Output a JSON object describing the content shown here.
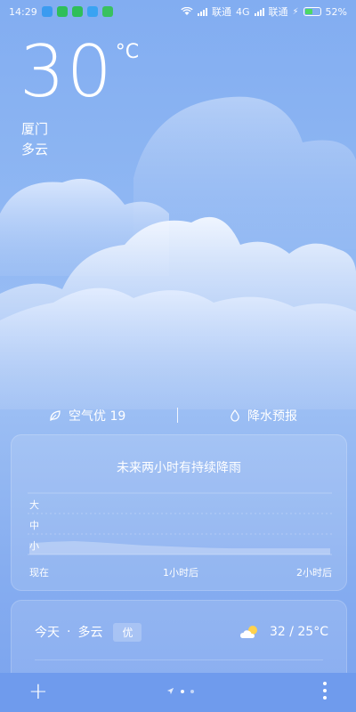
{
  "status_bar": {
    "time": "14:29",
    "carrier1": "联通",
    "network": "4G",
    "carrier2": "联通",
    "battery": "52%",
    "icons": [
      "usb-debug-icon",
      "wechat-icon",
      "wechat-icon",
      "app-icon",
      "android-icon",
      "wifi-icon",
      "signal-icon",
      "charging-icon"
    ]
  },
  "weather": {
    "temperature": "30",
    "unit": "°C",
    "city": "厦门",
    "condition": "多云"
  },
  "info_strip": {
    "aqi_label": "空气优 19",
    "precip_label": "降水预报"
  },
  "rain_card": {
    "title": "未来两小时有持续降雨",
    "y_labels": [
      "大",
      "中",
      "小"
    ],
    "x_labels": [
      "现在",
      "1小时后",
      "2小时后"
    ]
  },
  "chart_data": {
    "type": "area",
    "title": "未来两小时有持续降雨",
    "y_categories": [
      "小",
      "中",
      "大"
    ],
    "x": [
      0,
      0.15,
      0.3,
      0.45,
      0.6,
      0.75,
      0.9,
      1.05,
      1.2,
      1.35,
      1.5,
      1.65,
      1.8,
      1.95,
      2.0
    ],
    "values": [
      0.55,
      0.62,
      0.65,
      0.6,
      0.52,
      0.45,
      0.4,
      0.36,
      0.32,
      0.3,
      0.3,
      0.3,
      0.3,
      0.3,
      0.3
    ],
    "x_tick_labels": [
      "现在",
      "1小时后",
      "2小时后"
    ],
    "ylim": [
      0,
      3
    ],
    "xlim": [
      0,
      2
    ],
    "grid": true
  },
  "forecast": {
    "day": "今天",
    "separator": "·",
    "condition": "多云",
    "aqi_badge": "优",
    "temp_range": "32 / 25°C",
    "icon": "partly-cloudy-icon"
  },
  "bottom_bar": {
    "add_label": "+",
    "icons": [
      "add-icon",
      "location-icon",
      "more-icon"
    ]
  }
}
